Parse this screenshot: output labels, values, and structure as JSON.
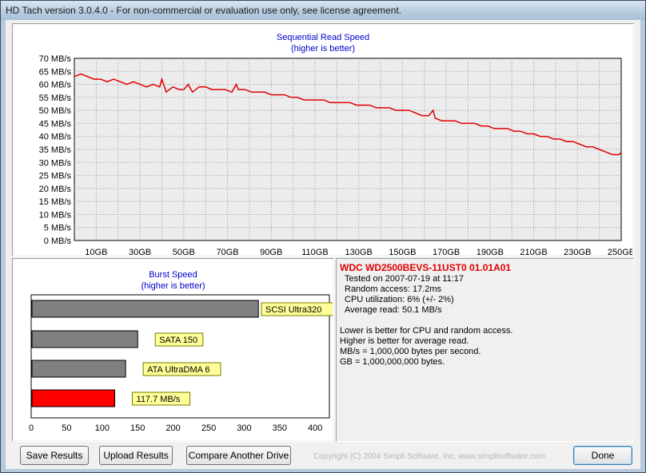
{
  "window": {
    "title": "HD Tach version 3.0.4.0  - For non-commercial or evaluation use only, see license agreement."
  },
  "read_chart": {
    "title": "Sequential Read Speed",
    "subtitle": "(higher is better)",
    "y_ticks": [
      "70 MB/s",
      "65 MB/s",
      "60 MB/s",
      "55 MB/s",
      "50 MB/s",
      "45 MB/s",
      "40 MB/s",
      "35 MB/s",
      "30 MB/s",
      "25 MB/s",
      "20 MB/s",
      "15 MB/s",
      "10 MB/s",
      "5 MB/s",
      "0 MB/s"
    ],
    "x_ticks": [
      "10GB",
      "30GB",
      "50GB",
      "70GB",
      "90GB",
      "110GB",
      "130GB",
      "150GB",
      "170GB",
      "190GB",
      "210GB",
      "230GB",
      "250GB"
    ],
    "line_color": "#e00000"
  },
  "burst_chart": {
    "title": "Burst Speed",
    "subtitle": "(higher is better)",
    "x_ticks": [
      "0",
      "50",
      "100",
      "150",
      "200",
      "250",
      "300",
      "350",
      "400"
    ]
  },
  "chart_data": [
    {
      "type": "line",
      "title": "Sequential Read Speed",
      "subtitle": "(higher is better)",
      "xlabel": "",
      "ylabel": "",
      "xlim": [
        0,
        250
      ],
      "ylim": [
        0,
        70
      ],
      "grid": true,
      "series": [
        {
          "color": "#e00000",
          "x": [
            0,
            3,
            6,
            9,
            12,
            15,
            18,
            21,
            24,
            27,
            30,
            33,
            36,
            39,
            40,
            42,
            45,
            48,
            50,
            52,
            54,
            57,
            60,
            63,
            66,
            69,
            72,
            74,
            75,
            78,
            81,
            84,
            87,
            90,
            93,
            96,
            99,
            102,
            105,
            108,
            111,
            114,
            117,
            120,
            123,
            126,
            129,
            132,
            135,
            138,
            141,
            144,
            147,
            150,
            153,
            156,
            159,
            162,
            164,
            165,
            168,
            171,
            174,
            177,
            180,
            183,
            186,
            189,
            192,
            195,
            198,
            201,
            204,
            207,
            210,
            213,
            216,
            219,
            222,
            225,
            228,
            231,
            234,
            237,
            240,
            243,
            246,
            249,
            250
          ],
          "y": [
            63,
            64,
            63,
            62,
            62,
            61,
            62,
            61,
            60,
            61,
            60,
            59,
            60,
            59,
            62,
            57,
            59,
            58,
            58,
            60,
            57,
            59,
            59,
            58,
            58,
            58,
            57,
            60,
            58,
            58,
            57,
            57,
            57,
            56,
            56,
            56,
            55,
            55,
            54,
            54,
            54,
            54,
            53,
            53,
            53,
            53,
            52,
            52,
            52,
            51,
            51,
            51,
            50,
            50,
            50,
            49,
            48,
            48,
            50,
            47,
            46,
            46,
            46,
            45,
            45,
            45,
            44,
            44,
            43,
            43,
            43,
            42,
            42,
            41,
            41,
            40,
            40,
            39,
            39,
            38,
            38,
            37,
            36,
            36,
            35,
            34,
            33,
            33,
            34
          ]
        }
      ]
    },
    {
      "type": "bar",
      "orientation": "horizontal",
      "title": "Burst Speed",
      "subtitle": "(higher is better)",
      "xlim": [
        0,
        420
      ],
      "categories": [
        "SCSI Ultra320",
        "SATA 150",
        "ATA UltraDMA 6",
        "117.7 MB/s"
      ],
      "values": [
        320,
        150,
        133,
        117.7
      ],
      "colors": [
        "#808080",
        "#808080",
        "#808080",
        "#ff0000"
      ]
    }
  ],
  "info": {
    "drive": "WDC WD2500BEVS-11UST0 01.01A01",
    "tested_on": "Tested on 2007-07-19 at 11:17",
    "random_access": "Random access: 17.2ms",
    "cpu": "CPU utilization: 6% (+/- 2%)",
    "avg_read": "Average read: 50.1 MB/s",
    "note1": "Lower is better for CPU and random access.",
    "note2": "Higher is better for average read.",
    "note3": "MB/s = 1,000,000 bytes per second.",
    "note4": "GB = 1,000,000,000 bytes."
  },
  "buttons": {
    "save": "Save Results",
    "upload": "Upload Results",
    "compare": "Compare Another Drive",
    "done": "Done"
  },
  "copyright": "Copyright (C) 2004 Simpli Software, Inc. www.simplisoftware.com"
}
